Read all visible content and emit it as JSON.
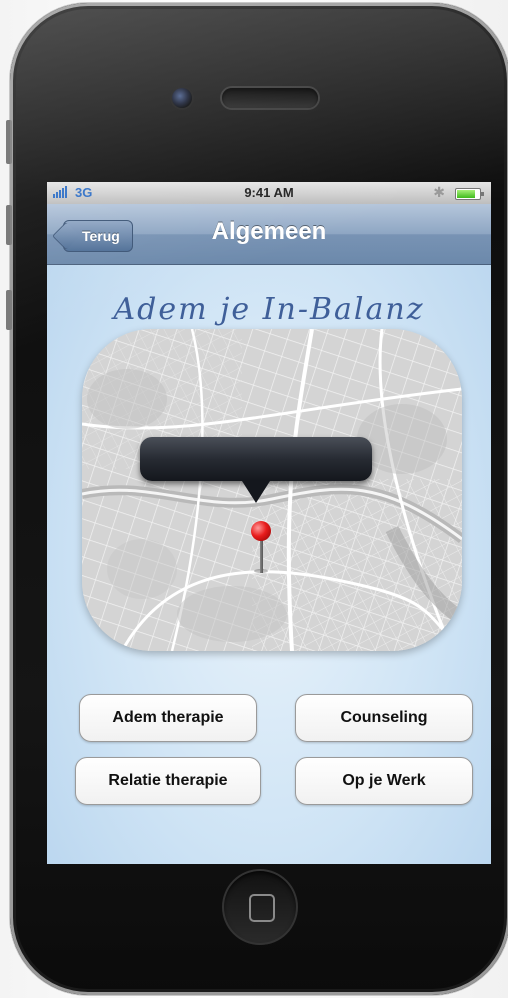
{
  "status_bar": {
    "carrier": "3G",
    "time": "9:41 AM",
    "battery_level": 0.8,
    "bluetooth_symbol": "✱"
  },
  "nav_bar": {
    "back_label": "Terug",
    "title": "Algemeen"
  },
  "headline": "Adem je In-Balanz",
  "buttons": [
    {
      "label": "Adem therapie"
    },
    {
      "label": "Counseling"
    },
    {
      "label": "Relatie therapie"
    },
    {
      "label": "Op je Werk"
    }
  ],
  "icons": [
    "signal-bars-icon",
    "bluetooth-icon",
    "battery-icon",
    "back-chevron-icon",
    "map-pin-icon",
    "home-button-icon"
  ],
  "colors": {
    "nav_bar": "#7893b4",
    "headline": "#3f5f99",
    "pin": "#e81c1c",
    "screen_background": "#cfe4f5"
  }
}
